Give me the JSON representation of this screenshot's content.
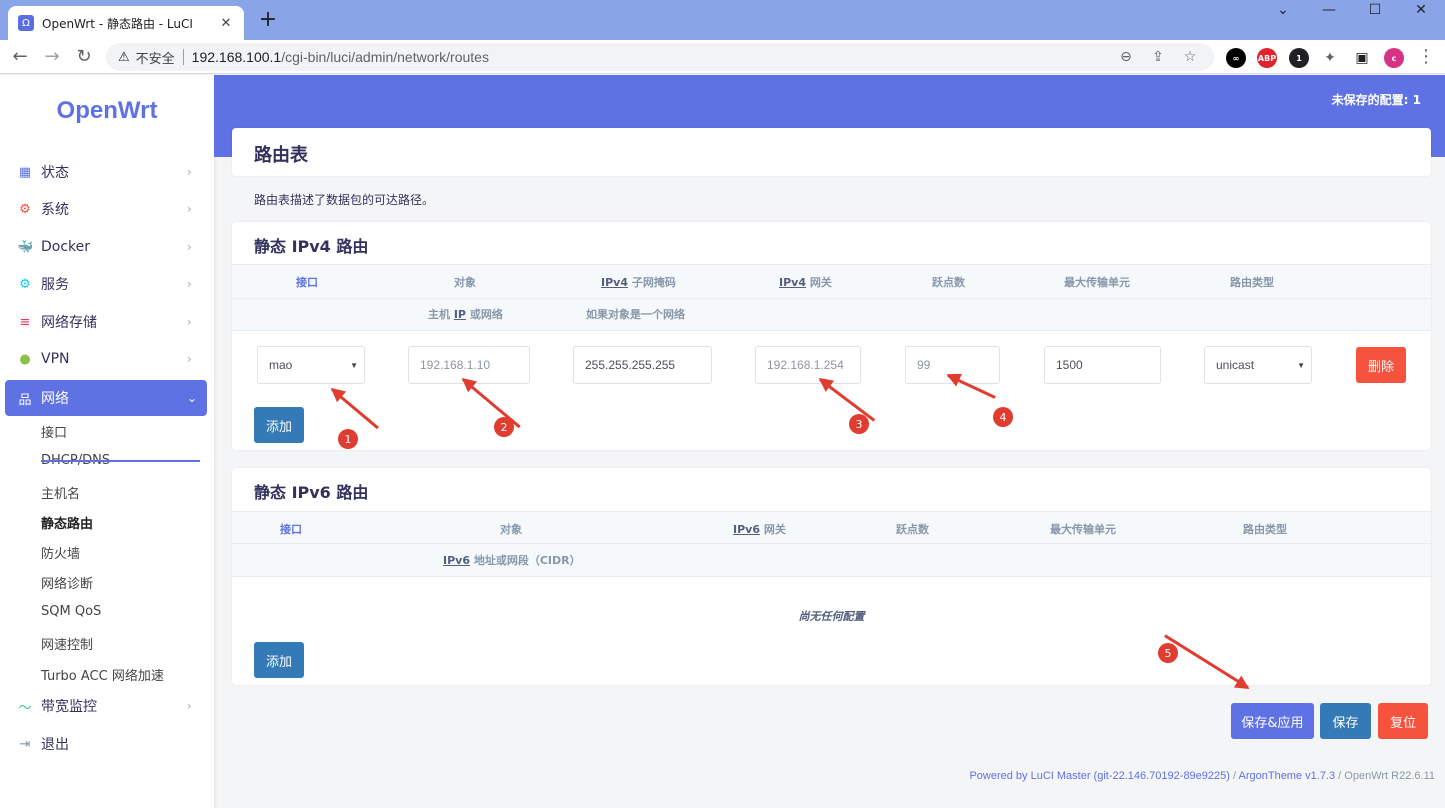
{
  "browser": {
    "tab_title": "OpenWrt - 静态路由 - LuCI",
    "tab_favicon": "Ω",
    "close_glyph": "✕",
    "newtab_glyph": "+",
    "window_controls": [
      "⌄",
      "—",
      "☐",
      "✕"
    ],
    "nav": {
      "back": "←",
      "forward": "→",
      "reload": "↻"
    },
    "insecure_label": "不安全",
    "url_host": "192.168.100.1",
    "url_path": "/cgi-bin/luci/admin/network/routes",
    "omni_icons": {
      "zoom": "⊖",
      "share": "⇪",
      "bookmark": "☆"
    },
    "extensions": [
      {
        "name": "infinity-ext-icon",
        "label": "∞",
        "color": "#000000"
      },
      {
        "name": "abp-icon",
        "label": "ABP",
        "color": "#e0232c"
      },
      {
        "name": "ext-badge-icon",
        "label": "1",
        "color": "#202124"
      },
      {
        "name": "puzzle-icon",
        "label": "✦",
        "color": "#5f6368"
      },
      {
        "name": "sidepanel-icon",
        "label": "▣",
        "color": "#202124"
      },
      {
        "name": "profile-avatar-icon",
        "label": "c",
        "color": "#d63384"
      }
    ],
    "menu_glyph": "⋮"
  },
  "sidebar": {
    "logo": "OpenWrt",
    "arrow_right": "›",
    "arrow_down": "⌄",
    "items": [
      {
        "label": "状态",
        "icon": "▦",
        "color": "#5e72e4"
      },
      {
        "label": "系统",
        "icon": "⚙",
        "color": "#f5533d"
      },
      {
        "label": "Docker",
        "icon": "🐳",
        "color": "#2496ed"
      },
      {
        "label": "服务",
        "icon": "⚙",
        "color": "#11cdef"
      },
      {
        "label": "网络存储",
        "icon": "≡",
        "color": "#f5365c"
      },
      {
        "label": "VPN",
        "icon": "●",
        "color": "#8bc34a"
      },
      {
        "label": "网络",
        "icon": "品",
        "color": "#ffffff"
      },
      {
        "label": "带宽监控",
        "icon": "〜",
        "color": "#2dce89"
      },
      {
        "label": "退出",
        "icon": "⇥",
        "color": "#8898aa"
      }
    ],
    "network_sub": [
      "接口",
      "DHCP/DNS",
      "主机名",
      "静态路由",
      "防火墙",
      "网络诊断",
      "SQM QoS",
      "网速控制",
      "Turbo ACC 网络加速"
    ]
  },
  "header": {
    "unsaved": "未保存的配置: 1"
  },
  "page": {
    "title": "路由表",
    "description": "路由表描述了数据包的可达路径。"
  },
  "ipv4": {
    "title": "静态 IPv4 路由",
    "columns": [
      {
        "pre": "",
        "abbr": "",
        "label": "接口"
      },
      {
        "pre": "",
        "abbr": "",
        "label": "对象"
      },
      {
        "pre": "",
        "abbr": "IPv4",
        "label": " 子网掩码"
      },
      {
        "pre": "",
        "abbr": "IPv4",
        "label": " 网关"
      },
      {
        "pre": "",
        "abbr": "",
        "label": "跃点数"
      },
      {
        "pre": "",
        "abbr": "",
        "label": "最大传输单元"
      },
      {
        "pre": "",
        "abbr": "",
        "label": "路由类型"
      }
    ],
    "hint_target_pre": "主机 ",
    "hint_target_abbr": "IP",
    "hint_target_post": " 或网络",
    "hint_mask": "如果对象是一个网络",
    "row": {
      "interface": "mao",
      "target": "192.168.1.10",
      "netmask": "255.255.255.255",
      "gateway": "192.168.1.254",
      "metric": "99",
      "mtu": "1500",
      "type": "unicast"
    },
    "delete_label": "删除",
    "add_label": "添加"
  },
  "ipv6": {
    "title": "静态 IPv6 路由",
    "columns": [
      {
        "abbr": "",
        "label": "接口"
      },
      {
        "abbr": "",
        "label": "对象"
      },
      {
        "abbr": "IPv6",
        "label": " 网关"
      },
      {
        "abbr": "",
        "label": "跃点数"
      },
      {
        "abbr": "",
        "label": "最大传输单元"
      },
      {
        "abbr": "",
        "label": "路由类型"
      }
    ],
    "hint_target_abbr": "IPv6",
    "hint_target_post": " 地址或网段（CIDR）",
    "empty": "尚无任何配置",
    "add_label": "添加"
  },
  "actions": {
    "save_apply": "保存&应用",
    "save": "保存",
    "reset": "复位"
  },
  "annotations": [
    "1",
    "2",
    "3",
    "4",
    "5"
  ],
  "footer": {
    "luci": "Powered by LuCI Master (git-22.146.70192-89e9225)",
    "divider": " / ",
    "theme": "ArgonTheme v1.7.3",
    "version": "OpenWrt R22.6.11"
  },
  "colors": {
    "accent": "#5e72e4",
    "danger": "#f5533d",
    "primary_btn": "#337ab7",
    "annotation": "#e03c30"
  }
}
